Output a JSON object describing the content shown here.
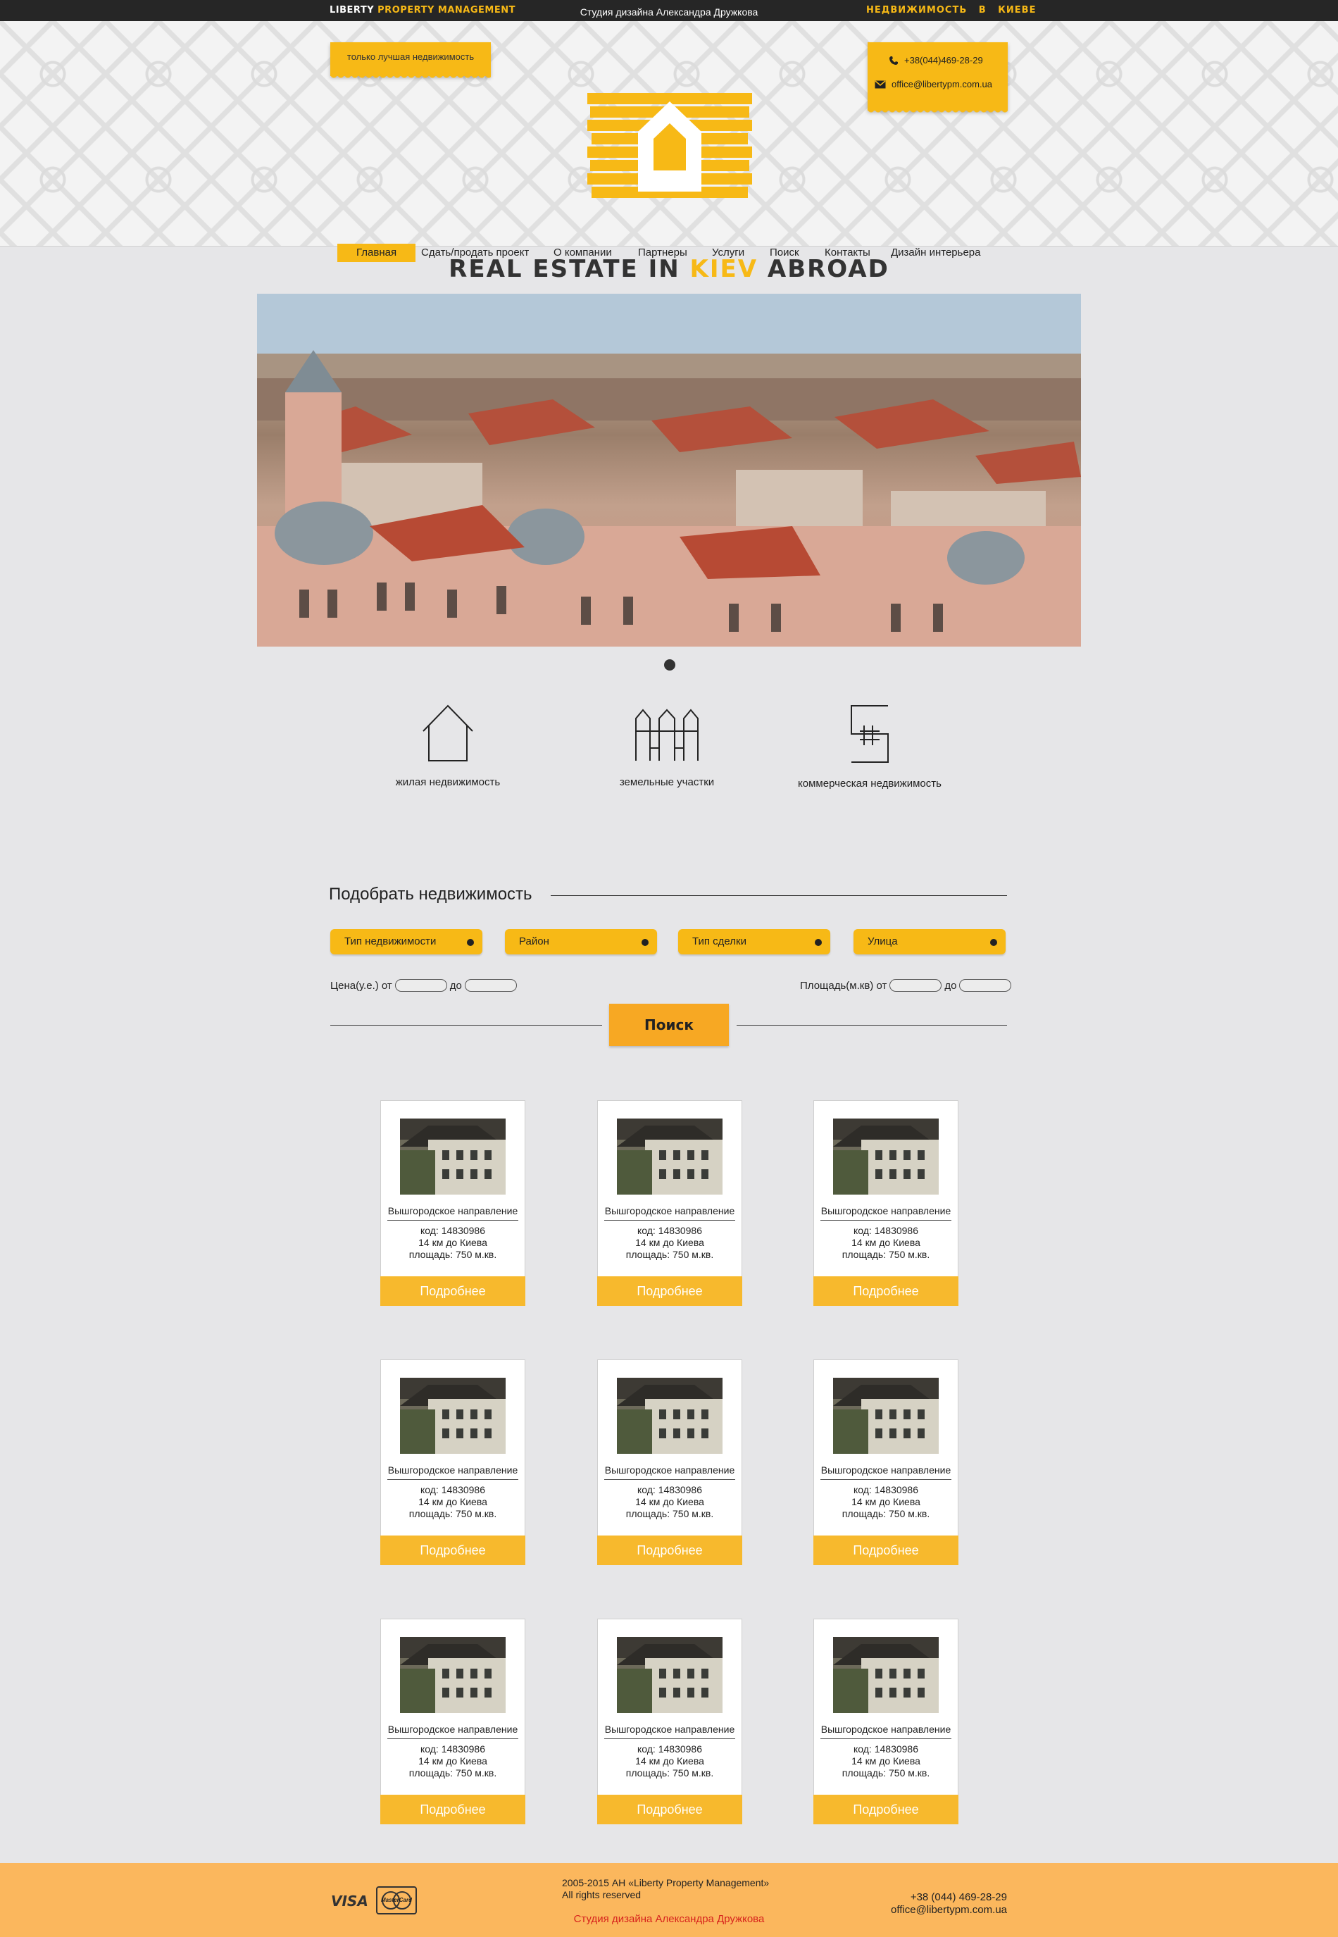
{
  "topbar": {
    "brand_1": "LIBERTY",
    "brand_2": "PROPERTY MANAGEMENT",
    "studio": "Студия дизайна Александра Дружкова",
    "realty": "НЕДВИЖИМОСТЬ   В   КИЕВЕ"
  },
  "header": {
    "tagline": "только лучшая недвижимость",
    "phone": "+38(044)469-28-29",
    "email": "office@libertypm.com.ua"
  },
  "nav": [
    {
      "label": "Главная",
      "active": true
    },
    {
      "label": "Сдать/продать проект"
    },
    {
      "label": "О компании"
    },
    {
      "label": "Партнеры"
    },
    {
      "label": "Услуги"
    },
    {
      "label": "Поиск"
    },
    {
      "label": "Контакты"
    },
    {
      "label": "Дизайн интерьера"
    }
  ],
  "hero": {
    "title_1": "REAL ESTATE IN ",
    "title_accent": "KIEV",
    "title_2": " ABROAD"
  },
  "categories": [
    {
      "label": "жилая недвижимость",
      "icon": "house-icon"
    },
    {
      "label": "земельные участки",
      "icon": "fence-icon"
    },
    {
      "label": "коммерческая недвижимость",
      "icon": "commercial-icon"
    }
  ],
  "search": {
    "title": "Подобрать недвижимость",
    "selects": [
      "Тип недвижимости",
      "Район",
      "Тип сделки",
      "Улица"
    ],
    "price_label": "Цена(у.е.) от",
    "area_label": "Площадь(м.кв) от",
    "to_label": "до",
    "button": "Поиск"
  },
  "listing": {
    "name": "Вышгородское направление",
    "code": "код: 14830986",
    "distance": "14 км до Киева",
    "area": "площадь: 750 м.кв.",
    "more": "Подробнее"
  },
  "footer": {
    "visa": "VISA",
    "mastercard": "MasterCard",
    "copyright": "2005-2015 АН «Liberty Property Management»",
    "rights": "All rights reserved",
    "studio": "Студия дизайна Александра Дружкова",
    "phone": "+38 (044) 469-28-29",
    "email": "office@libertypm.com.ua"
  },
  "colors": {
    "accent": "#f7b916",
    "topbar": "#262626",
    "footer": "#fbb75d",
    "studio_link": "#d7231d"
  }
}
